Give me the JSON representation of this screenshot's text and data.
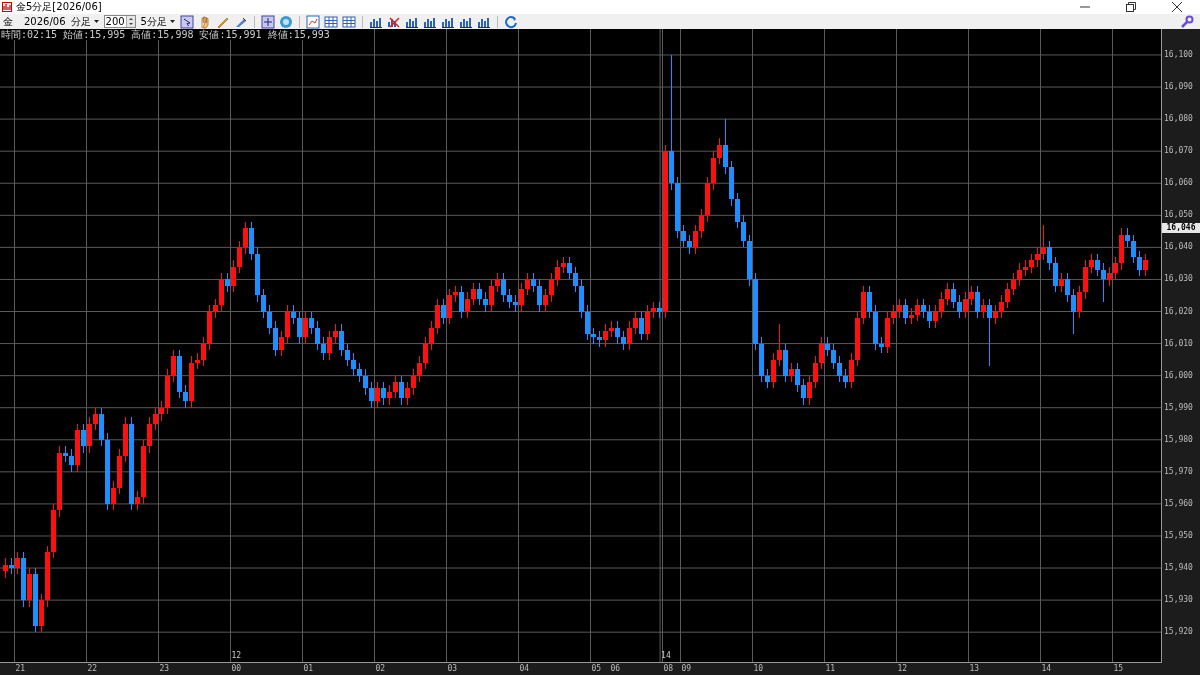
{
  "window": {
    "title": "金5分足[2026/06]"
  },
  "time_axis": {
    "labels": [
      "21",
      "22",
      "23",
      "00",
      "01",
      "02",
      "03",
      "04",
      "05",
      "06",
      "08",
      "09",
      "10",
      "11",
      "12",
      "13",
      "14",
      "15"
    ]
  },
  "toolbar": {
    "symbol": "金",
    "contract_month": "2026/06",
    "period_unit": "分足",
    "bar_count": "200",
    "period": "5分足"
  },
  "info_line": "時間:02:15 始値:15,995 高値:15,998 安値:15,991 終値:15,993",
  "chart": {
    "current_price": "16,046",
    "date_markers": [
      "12",
      "14"
    ],
    "chart_data": {
      "type": "candlestick",
      "ylim": [
        15910.7,
        16108.1
      ],
      "yticks": [
        {
          "value": 16100,
          "label": "16,100"
        },
        {
          "value": 16090,
          "label": "16,090"
        },
        {
          "value": 16080,
          "label": "16,080"
        },
        {
          "value": 16070,
          "label": "16,070"
        },
        {
          "value": 16060,
          "label": "16,060"
        },
        {
          "value": 16050,
          "label": "16,050"
        },
        {
          "value": 16040,
          "label": "16,040"
        },
        {
          "value": 16030,
          "label": "16,030"
        },
        {
          "value": 16020,
          "label": "16,020"
        },
        {
          "value": 16010,
          "label": "16,010"
        },
        {
          "value": 16000,
          "label": "16,000"
        },
        {
          "value": 15990,
          "label": "15,990"
        },
        {
          "value": 15980,
          "label": "15,980"
        },
        {
          "value": 15970,
          "label": "15,970"
        },
        {
          "value": 15960,
          "label": "15,960"
        },
        {
          "value": 15950,
          "label": "15,950"
        },
        {
          "value": 15940,
          "label": "15,940"
        },
        {
          "value": 15930,
          "label": "15,930"
        },
        {
          "value": 15920,
          "label": "15,920"
        }
      ],
      "grid": true,
      "categories": [
        null,
        null,
        null,
        null,
        null,
        null,
        null,
        null,
        null,
        null,
        null,
        null,
        null,
        null,
        null,
        null,
        null,
        null,
        null,
        null,
        null,
        null,
        null,
        null,
        null,
        null,
        null,
        null,
        null,
        null,
        null,
        null,
        null,
        null,
        null,
        null,
        null,
        null,
        null,
        null,
        null,
        null,
        null,
        null,
        null,
        null,
        null,
        null,
        null,
        null,
        null,
        null,
        null,
        null,
        null,
        null,
        null,
        null,
        null,
        null,
        null,
        null,
        null,
        null,
        null,
        null,
        null,
        null,
        null,
        null,
        null,
        null,
        null,
        null,
        null,
        null,
        null,
        null,
        null,
        null,
        null,
        null,
        null,
        null,
        null,
        null,
        null,
        null,
        null,
        null,
        null,
        null,
        null,
        null,
        null,
        null,
        null,
        null,
        null,
        null,
        null,
        null,
        null,
        null,
        null,
        null,
        null,
        null,
        null,
        null,
        null,
        null,
        null,
        null,
        null,
        null,
        null,
        null,
        null,
        null,
        null,
        null,
        null,
        null,
        null,
        null,
        null,
        null,
        null,
        null,
        null,
        null,
        null,
        null,
        null,
        null,
        null,
        null,
        null,
        null,
        null,
        null,
        null,
        null,
        null,
        null,
        null,
        null,
        null,
        null,
        null,
        null,
        null,
        null,
        null,
        null,
        null,
        null,
        null,
        null,
        null,
        null,
        null,
        null,
        null,
        null,
        null,
        null,
        null,
        null,
        null,
        null,
        null,
        null,
        null,
        null,
        null,
        null,
        null,
        null,
        null,
        null,
        null,
        null,
        null,
        null,
        null,
        null,
        null,
        null,
        null
      ],
      "ohlc": [
        [
          15939,
          15943,
          15937,
          15941
        ],
        [
          15941,
          15943,
          15938,
          15940
        ],
        [
          15940,
          15945,
          15938,
          15943
        ],
        [
          15943,
          15945,
          15928,
          15930
        ],
        [
          15930,
          15940,
          15928,
          15938
        ],
        [
          15938,
          15940,
          15920,
          15922
        ],
        [
          15922,
          15932,
          15920,
          15930
        ],
        [
          15930,
          15947,
          15928,
          15945
        ],
        [
          15945,
          15960,
          15943,
          15958
        ],
        [
          15958,
          15978,
          15956,
          15976
        ],
        [
          15976,
          15978,
          15973,
          15975
        ],
        [
          15975,
          15977,
          15970,
          15972
        ],
        [
          15972,
          15985,
          15970,
          15983
        ],
        [
          15983,
          15985,
          15976,
          15978
        ],
        [
          15978,
          15987,
          15976,
          15985
        ],
        [
          15985,
          15990,
          15983,
          15988
        ],
        [
          15988,
          15990,
          15978,
          15980
        ],
        [
          15980,
          15982,
          15958,
          15960
        ],
        [
          15960,
          15967,
          15958,
          15965
        ],
        [
          15965,
          15977,
          15963,
          15975
        ],
        [
          15975,
          15987,
          15973,
          15985
        ],
        [
          15985,
          15987,
          15958,
          15960
        ],
        [
          15960,
          15964,
          15958,
          15962
        ],
        [
          15962,
          15980,
          15960,
          15978
        ],
        [
          15978,
          15987,
          15976,
          15985
        ],
        [
          15985,
          15990,
          15983,
          15988
        ],
        [
          15988,
          15992,
          15986,
          15990
        ],
        [
          15990,
          16002,
          15988,
          16000
        ],
        [
          16000,
          16008,
          15998,
          16006
        ],
        [
          16006,
          16008,
          15993,
          15995
        ],
        [
          15995,
          15997,
          15990,
          15992
        ],
        [
          15992,
          16006,
          15990,
          16004
        ],
        [
          16004,
          16007,
          16002,
          16005
        ],
        [
          16005,
          16012,
          16003,
          16010
        ],
        [
          16010,
          16022,
          16008,
          16020
        ],
        [
          16020,
          16024,
          16018,
          16022
        ],
        [
          16022,
          16032,
          16020,
          16030
        ],
        [
          16030,
          16032,
          16026,
          16028
        ],
        [
          16028,
          16036,
          16026,
          16034
        ],
        [
          16034,
          16042,
          16032,
          16040
        ],
        [
          16040,
          16048,
          16038,
          16046
        ],
        [
          16046,
          16048,
          16036,
          16038
        ],
        [
          16038,
          16040,
          16023,
          16025
        ],
        [
          16025,
          16027,
          16018,
          16020
        ],
        [
          16020,
          16022,
          16013,
          16015
        ],
        [
          16015,
          16017,
          16006,
          16008
        ],
        [
          16008,
          16014,
          16006,
          16012
        ],
        [
          16012,
          16022,
          16010,
          16020
        ],
        [
          16020,
          16022,
          16016,
          16018
        ],
        [
          16018,
          16020,
          16010,
          16012
        ],
        [
          16012,
          16020,
          16010,
          16018
        ],
        [
          16018,
          16020,
          16013,
          16015
        ],
        [
          16015,
          16017,
          16008,
          16010
        ],
        [
          16010,
          16012,
          16005,
          16007
        ],
        [
          16007,
          16014,
          16005,
          16012
        ],
        [
          16012,
          16016,
          16010,
          16014
        ],
        [
          16014,
          16016,
          16006,
          16008
        ],
        [
          16008,
          16010,
          16003,
          16005
        ],
        [
          16005,
          16007,
          16000,
          16002
        ],
        [
          16002,
          16004,
          15998,
          16000
        ],
        [
          16000,
          16002,
          15994,
          15996
        ],
        [
          15996,
          15998,
          15990,
          15992
        ],
        [
          15992,
          15998,
          15990,
          15996
        ],
        [
          15996,
          15998,
          15991,
          15993
        ],
        [
          15993,
          15997,
          15991,
          15995
        ],
        [
          15995,
          16000,
          15993,
          15998
        ],
        [
          15998,
          16000,
          15991,
          15993
        ],
        [
          15993,
          15998,
          15991,
          15996
        ],
        [
          15996,
          16002,
          15994,
          16000
        ],
        [
          16000,
          16006,
          15998,
          16004
        ],
        [
          16004,
          16012,
          16002,
          16010
        ],
        [
          16010,
          16017,
          16008,
          16015
        ],
        [
          16015,
          16024,
          16013,
          16022
        ],
        [
          16022,
          16024,
          16016,
          16018
        ],
        [
          16018,
          16027,
          16016,
          16025
        ],
        [
          16025,
          16028,
          16023,
          16026
        ],
        [
          16026,
          16028,
          16018,
          16020
        ],
        [
          16020,
          16026,
          16018,
          16024
        ],
        [
          16024,
          16029,
          16022,
          16027
        ],
        [
          16027,
          16029,
          16022,
          16024
        ],
        [
          16024,
          16026,
          16020,
          16022
        ],
        [
          16022,
          16030,
          16020,
          16028
        ],
        [
          16028,
          16032,
          16026,
          16030
        ],
        [
          16030,
          16032,
          16023,
          16025
        ],
        [
          16025,
          16027,
          16021,
          16023
        ],
        [
          16023,
          16025,
          16020,
          16022
        ],
        [
          16022,
          16029,
          16020,
          16027
        ],
        [
          16027,
          16032,
          16025,
          16030
        ],
        [
          16030,
          16032,
          16026,
          16028
        ],
        [
          16028,
          16030,
          16020,
          16022
        ],
        [
          16022,
          16027,
          16020,
          16025
        ],
        [
          16025,
          16032,
          16023,
          16030
        ],
        [
          16030,
          16036,
          16028,
          16034
        ],
        [
          16034,
          16037,
          16032,
          16035
        ],
        [
          16035,
          16037,
          16030,
          16032
        ],
        [
          16032,
          16034,
          16026,
          16028
        ],
        [
          16028,
          16030,
          16018,
          16020
        ],
        [
          16020,
          16022,
          16011,
          16013
        ],
        [
          16013,
          16015,
          16010,
          16012
        ],
        [
          16012,
          16014,
          16009,
          16011
        ],
        [
          16011,
          16016,
          16009,
          16014
        ],
        [
          16014,
          16017,
          16012,
          16015
        ],
        [
          16015,
          16017,
          16010,
          16012
        ],
        [
          16012,
          16014,
          16008,
          16010
        ],
        [
          16010,
          16017,
          16008,
          16015
        ],
        [
          16015,
          16020,
          16013,
          16018
        ],
        [
          16018,
          16020,
          16011,
          16013
        ],
        [
          16013,
          16022,
          16011,
          16020
        ],
        [
          16020,
          16023,
          16018,
          16021
        ],
        [
          16021,
          16023,
          16018,
          16020
        ],
        [
          16020,
          16072,
          16018,
          16070
        ],
        [
          16070,
          16100,
          16058,
          16060
        ],
        [
          16060,
          16062,
          16043,
          16045
        ],
        [
          16045,
          16047,
          16040,
          16042
        ],
        [
          16042,
          16044,
          16038,
          16040
        ],
        [
          16040,
          16047,
          16038,
          16045
        ],
        [
          16045,
          16052,
          16043,
          16050
        ],
        [
          16050,
          16062,
          16048,
          16060
        ],
        [
          16060,
          16070,
          16058,
          16068
        ],
        [
          16068,
          16074,
          16066,
          16072
        ],
        [
          16072,
          16080,
          16063,
          16065
        ],
        [
          16065,
          16067,
          16053,
          16055
        ],
        [
          16055,
          16057,
          16046,
          16048
        ],
        [
          16048,
          16050,
          16040,
          16042
        ],
        [
          16042,
          16044,
          16028,
          16030
        ],
        [
          16030,
          16032,
          16008,
          16010
        ],
        [
          16010,
          16012,
          15998,
          16000
        ],
        [
          16000,
          16002,
          15996,
          15998
        ],
        [
          15998,
          16007,
          15996,
          16005
        ],
        [
          16005,
          16016,
          16003,
          16008
        ],
        [
          16008,
          16010,
          15998,
          16000
        ],
        [
          16000,
          16004,
          15998,
          16002
        ],
        [
          16002,
          16004,
          15995,
          15997
        ],
        [
          15997,
          15999,
          15991,
          15993
        ],
        [
          15993,
          16000,
          15991,
          15998
        ],
        [
          15998,
          16006,
          15996,
          16004
        ],
        [
          16004,
          16012,
          16002,
          16010
        ],
        [
          16010,
          16012,
          16006,
          16008
        ],
        [
          16008,
          16010,
          16002,
          16004
        ],
        [
          16004,
          16006,
          15998,
          16000
        ],
        [
          16000,
          16002,
          15996,
          15998
        ],
        [
          15998,
          16007,
          15996,
          16005
        ],
        [
          16005,
          16020,
          16003,
          16018
        ],
        [
          16018,
          16028,
          16016,
          16026
        ],
        [
          16026,
          16028,
          16018,
          16020
        ],
        [
          16020,
          16022,
          16008,
          16010
        ],
        [
          16010,
          16012,
          16007,
          16009
        ],
        [
          16009,
          16020,
          16007,
          16018
        ],
        [
          16018,
          16022,
          16016,
          16020
        ],
        [
          16020,
          16024,
          16018,
          16022
        ],
        [
          16022,
          16024,
          16016,
          16018
        ],
        [
          16018,
          16021,
          16016,
          16019
        ],
        [
          16019,
          16024,
          16017,
          16022
        ],
        [
          16022,
          16024,
          16018,
          16020
        ],
        [
          16020,
          16022,
          16015,
          16017
        ],
        [
          16017,
          16022,
          16015,
          16020
        ],
        [
          16020,
          16026,
          16018,
          16024
        ],
        [
          16024,
          16029,
          16022,
          16027
        ],
        [
          16027,
          16029,
          16021,
          16023
        ],
        [
          16023,
          16025,
          16018,
          16020
        ],
        [
          16020,
          16026,
          16018,
          16024
        ],
        [
          16024,
          16028,
          16022,
          16026
        ],
        [
          16026,
          16028,
          16018,
          16020
        ],
        [
          16020,
          16024,
          16018,
          16022
        ],
        [
          16022,
          16024,
          16003,
          16018
        ],
        [
          16018,
          16022,
          16016,
          16020
        ],
        [
          16020,
          16025,
          16018,
          16023
        ],
        [
          16023,
          16029,
          16021,
          16027
        ],
        [
          16027,
          16032,
          16025,
          16030
        ],
        [
          16030,
          16035,
          16028,
          16033
        ],
        [
          16033,
          16036,
          16031,
          16034
        ],
        [
          16034,
          16038,
          16032,
          16036
        ],
        [
          16036,
          16040,
          16034,
          16038
        ],
        [
          16038,
          16047,
          16036,
          16040
        ],
        [
          16040,
          16042,
          16033,
          16035
        ],
        [
          16035,
          16037,
          16026,
          16028
        ],
        [
          16028,
          16032,
          16026,
          16030
        ],
        [
          16030,
          16032,
          16023,
          16025
        ],
        [
          16025,
          16027,
          16013,
          16020
        ],
        [
          16020,
          16028,
          16018,
          16026
        ],
        [
          16026,
          16036,
          16024,
          16034
        ],
        [
          16034,
          16038,
          16032,
          16036
        ],
        [
          16036,
          16038,
          16031,
          16033
        ],
        [
          16033,
          16035,
          16023,
          16030
        ],
        [
          16030,
          16034,
          16028,
          16032
        ],
        [
          16032,
          16037,
          16030,
          16035
        ],
        [
          16035,
          16046,
          16033,
          16044
        ],
        [
          16044,
          16046,
          16040,
          16042
        ],
        [
          16042,
          16044,
          16035,
          16037
        ],
        [
          16037,
          16039,
          16031,
          16033
        ],
        [
          16033,
          16038,
          16031,
          16036
        ]
      ]
    }
  }
}
